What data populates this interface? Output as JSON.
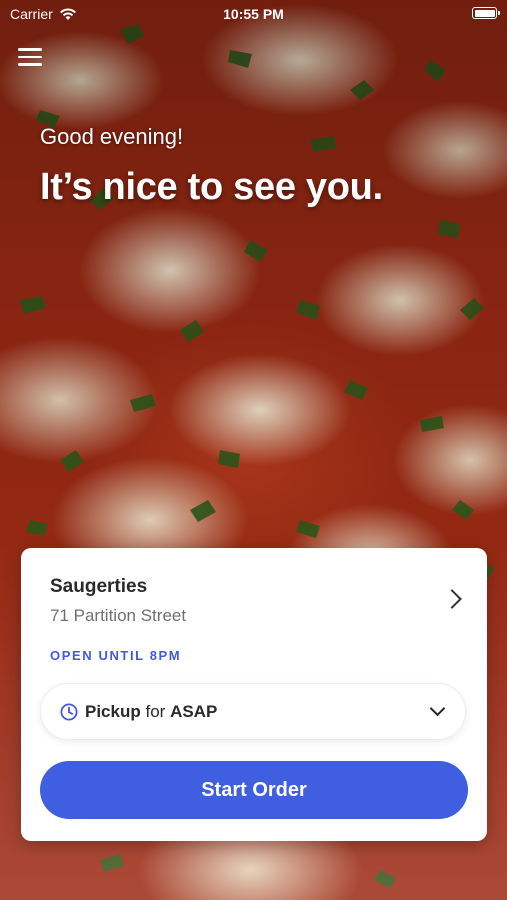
{
  "status_bar": {
    "carrier": "Carrier",
    "time": "10:55 PM"
  },
  "hero": {
    "greeting": "Good evening!",
    "headline": "It’s nice to see you."
  },
  "location": {
    "name": "Saugerties",
    "address": "71 Partition Street",
    "hours": "OPEN UNTIL 8PM"
  },
  "order_mode": {
    "mode": "Pickup",
    "connector": "for",
    "time": "ASAP"
  },
  "actions": {
    "start_order_label": "Start Order"
  },
  "colors": {
    "accent": "#3f5ee0",
    "hours_text": "#4459e0"
  },
  "icons": {
    "menu": "hamburger-menu-icon",
    "wifi": "wifi-icon",
    "battery": "battery-icon",
    "clock": "clock-icon",
    "chevron_right": "chevron-right-icon",
    "chevron_down": "chevron-down-icon"
  }
}
